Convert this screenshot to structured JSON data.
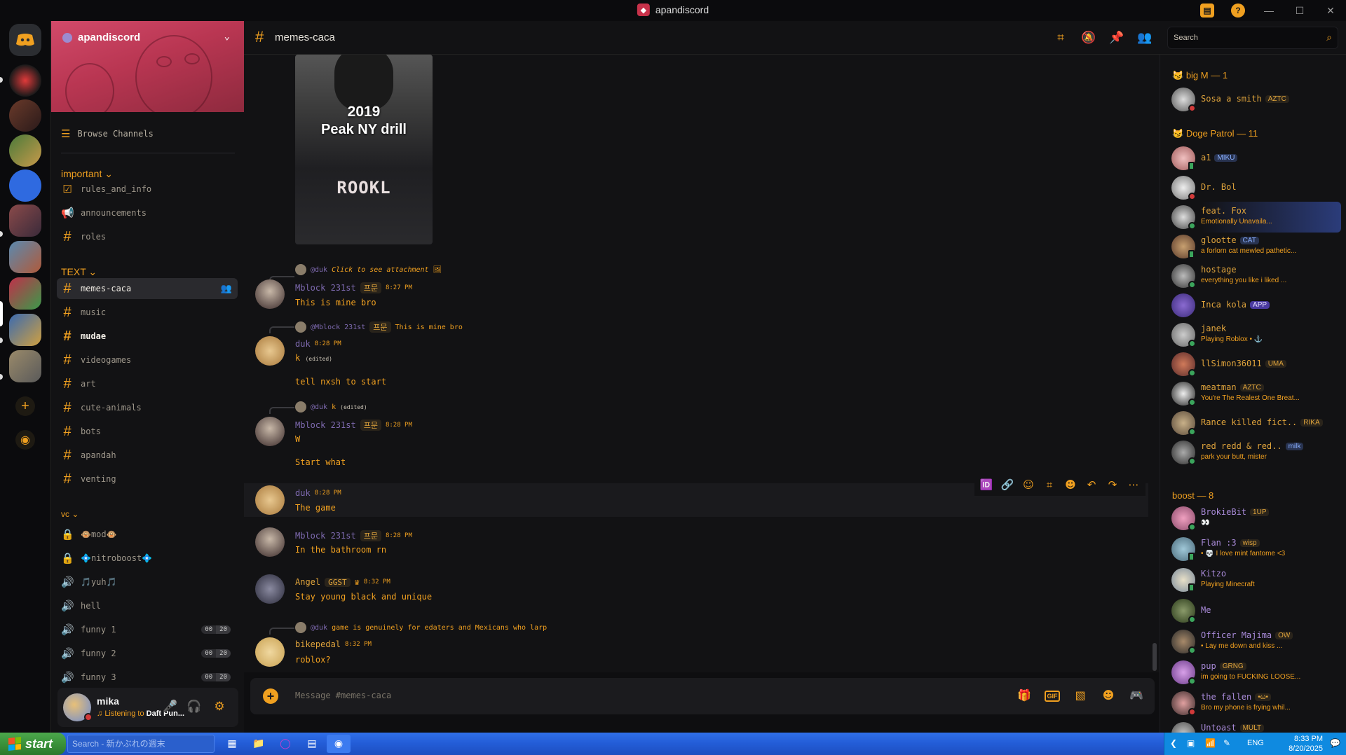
{
  "window": {
    "title": "apandiscord"
  },
  "server": {
    "name": "apandiscord"
  },
  "browse_label": "Browse Channels",
  "categories": {
    "important": "important",
    "text": "TEXT",
    "vc": "vc"
  },
  "channels": {
    "important": [
      "rules_and_info",
      "announcements",
      "roles"
    ],
    "text": [
      "memes-caca",
      "music",
      "mudae",
      "videogames",
      "art",
      "cute-animals",
      "bots",
      "apandah",
      "venting"
    ],
    "voice": [
      {
        "name": "🐵mod🐵"
      },
      {
        "name": "💠nitroboost💠"
      },
      {
        "name": "🎵yuh🎵"
      },
      {
        "name": "hell"
      },
      {
        "name": "funny 1",
        "count": "00",
        "limit": "20"
      },
      {
        "name": "funny 2",
        "count": "00",
        "limit": "20"
      },
      {
        "name": "funny 3",
        "count": "00",
        "limit": "20"
      }
    ]
  },
  "user": {
    "name": "mika",
    "status_prefix": "Listening to ",
    "status_bold": "Daft Pun..."
  },
  "header": {
    "channel": "memes-caca",
    "search_placeholder": "Search"
  },
  "media": {
    "caption_year": "2019",
    "caption_title": "Peak NY drill",
    "shirt_text": "ROOKL"
  },
  "messages": [
    {
      "reply_to": "@duk",
      "reply_text": "Click to see attachment",
      "author": "Mblock 231st",
      "tag": "프문",
      "time": "8:27 PM",
      "lines": [
        "This is mine bro"
      ]
    },
    {
      "reply_to": "@Mblock 231st",
      "reply_tag": "프문",
      "reply_text": "This is mine bro",
      "author": "duk",
      "time": "8:28 PM",
      "lines": [
        "k",
        "tell nxsh to start"
      ],
      "edited": "(edited)"
    },
    {
      "reply_to": "@duk",
      "reply_text": "k",
      "reply_edited": "(edited)",
      "author": "Mblock 231st",
      "tag": "프문",
      "time": "8:28 PM",
      "lines": [
        "W",
        "Start what"
      ]
    },
    {
      "author": "duk",
      "time": "8:28 PM",
      "lines": [
        "The game"
      ]
    },
    {
      "author": "Mblock 231st",
      "tag": "프문",
      "time": "8:28 PM",
      "lines": [
        "In the bathroom rn"
      ]
    },
    {
      "author": "Angel",
      "tag": "GGST",
      "time": "8:32 PM",
      "lines": [
        "Stay young black and unique"
      ]
    },
    {
      "reply_to": "@duk",
      "reply_text": "game is genuinely for edaters and Mexicans who larp",
      "author": "bikepedal",
      "time": "8:32 PM",
      "lines": [
        "roblox?"
      ]
    }
  ],
  "composer": {
    "placeholder": "Message #memes-caca",
    "gif_label": "GIF"
  },
  "member_groups": [
    {
      "title": "big M — 1"
    },
    {
      "title": "Doge Patrol — 11"
    },
    {
      "title": "boost — 8"
    }
  ],
  "members": [
    {
      "name": "Sosa a smith",
      "tag": "AZTC",
      "sub": ""
    },
    {
      "name": "a1",
      "tag": "MIKU",
      "sub": ""
    },
    {
      "name": "Dr. Bol",
      "tag": "",
      "sub": ""
    },
    {
      "name": "feat. Fox",
      "tag": "",
      "sub": "Emotionally Unavaila..."
    },
    {
      "name": "glootte",
      "tag": "CAT",
      "sub": "a forlorn cat mewled pathetic..."
    },
    {
      "name": "hostage",
      "tag": "",
      "sub": "everything you like i liked ..."
    },
    {
      "name": "Inca kola",
      "tag": "APP",
      "sub": ""
    },
    {
      "name": "janek",
      "tag": "",
      "sub": "Playing Roblox • ⚓"
    },
    {
      "name": "llSimon36011",
      "tag": "UMA",
      "sub": ""
    },
    {
      "name": "meatman",
      "tag": "AZTC",
      "sub": "You're The Realest One Breat..."
    },
    {
      "name": "Rance killed fict..",
      "tag": "RIKA",
      "sub": ""
    },
    {
      "name": "red redd & red..",
      "tag": "milk",
      "sub": "park your butt, mister"
    },
    {
      "name": "BrokieBit",
      "tag": "1UP",
      "sub": "👀"
    },
    {
      "name": "Flan :3",
      "tag": "wisp",
      "sub": "• 💀 I love mint fantome <3"
    },
    {
      "name": "Kitzo",
      "tag": "",
      "sub": "Playing Minecraft"
    },
    {
      "name": "Me",
      "tag": "",
      "sub": ""
    },
    {
      "name": "Officer Majima",
      "tag": "OW",
      "sub": "• Lay me down and kiss ..."
    },
    {
      "name": "pup",
      "tag": "GRNG",
      "sub": "im going to FUCKING LOOSE..."
    },
    {
      "name": "the fallen",
      "tag": "•ω•",
      "sub": "Bro my phone is frying whil..."
    },
    {
      "name": "Untoast",
      "tag": "MULT",
      "sub": ""
    }
  ],
  "taskbar": {
    "start_label": "start",
    "search_text": "Search - 新かぶれの週末",
    "lang": "ENG",
    "time": "8:33 PM",
    "date": "8/20/2025"
  }
}
